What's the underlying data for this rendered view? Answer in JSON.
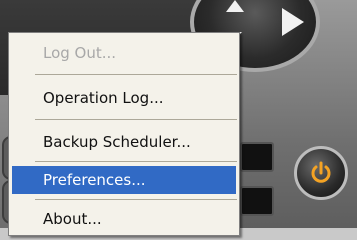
{
  "context_menu": {
    "items": [
      {
        "label": "Log Out...",
        "disabled": true,
        "selected": false
      },
      {
        "label": "Operation Log...",
        "disabled": false,
        "selected": false
      },
      {
        "label": "Backup Scheduler...",
        "disabled": false,
        "selected": false
      },
      {
        "label": "Preferences...",
        "disabled": false,
        "selected": true
      },
      {
        "label": "About...",
        "disabled": false,
        "selected": false
      }
    ]
  },
  "icons": {
    "nav_right": "play-arrow-icon",
    "nav_up": "up-arrow-icon",
    "nav_diag": "diagonal-arrow-icon",
    "power": "power-icon"
  },
  "colors": {
    "selection": "#316ac5",
    "menu_background": "#f4f2ea",
    "power_accent": "#f4a324"
  }
}
